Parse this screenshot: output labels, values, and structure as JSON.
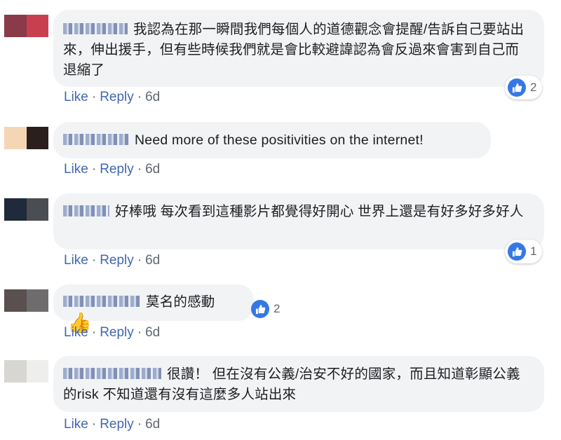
{
  "colors": {
    "link": "#4267b2",
    "meta": "#616770",
    "bubble": "#f2f3f5",
    "like_badge": "#3578e5"
  },
  "comments": [
    {
      "text": "我認為在那一瞬間我們每個人的道德觀念會提醒/告訴自己要站出來，伸出援手，但有些時候我們就是會比較避諱認為會反過來會害到自己而退縮了",
      "like": "Like",
      "reply": "Reply",
      "time": "6d",
      "reactions": "2"
    },
    {
      "text": "Need more of these positivities on the internet!",
      "like": "Like",
      "reply": "Reply",
      "time": "6d"
    },
    {
      "text": "好棒哦 每次看到這種影片都覺得好開心 世界上還是有好多好多好人",
      "like": "Like",
      "reply": "Reply",
      "time": "6d",
      "reactions": "1"
    },
    {
      "text": "莫名的感動",
      "emoji": "thumbs-up",
      "like": "Like",
      "reply": "Reply",
      "time": "6d",
      "reactions": "2"
    },
    {
      "text": "很讚！ 但在沒有公義/治安不好的國家，而且知道彰顯公義的risk 不知道還有沒有這麼多人站出來",
      "like": "Like",
      "reply": "Reply",
      "time": "6d"
    }
  ]
}
